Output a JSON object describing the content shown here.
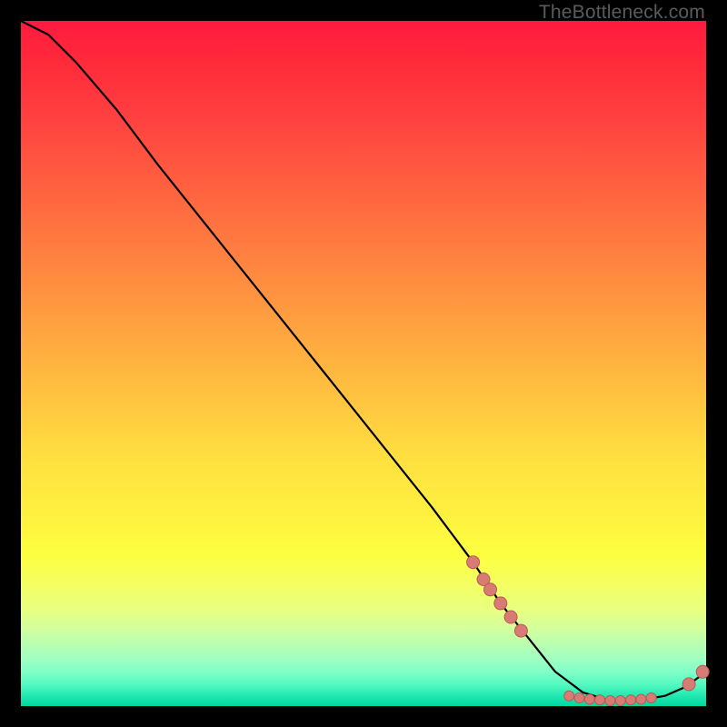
{
  "watermark": "TheBottleneck.com",
  "chart_data": {
    "type": "line",
    "title": "",
    "xlabel": "",
    "ylabel": "",
    "xlim": [
      0,
      100
    ],
    "ylim": [
      0,
      100
    ],
    "curve": {
      "x": [
        0,
        4,
        8,
        14,
        20,
        28,
        36,
        44,
        52,
        60,
        66,
        70,
        74,
        78,
        82,
        86,
        90,
        94,
        97,
        100
      ],
      "y": [
        100,
        98,
        94,
        87,
        79,
        69,
        59,
        49,
        39,
        29,
        21,
        15,
        10,
        5,
        2,
        0.8,
        0.8,
        1.5,
        2.8,
        5
      ]
    },
    "points_left_cluster": {
      "x": [
        66,
        67.5,
        68.5,
        70,
        71.5,
        73
      ],
      "y": [
        21,
        18.5,
        17,
        15,
        13,
        11
      ]
    },
    "points_bottom_cluster": {
      "x": [
        80,
        81.5,
        83,
        84.5,
        86,
        87.5,
        89,
        90.5,
        92
      ],
      "y": [
        1.5,
        1.2,
        1.0,
        0.9,
        0.8,
        0.8,
        0.9,
        1.0,
        1.2
      ]
    },
    "points_right_cluster": {
      "x": [
        97.5,
        99.5
      ],
      "y": [
        3.2,
        5.0
      ]
    },
    "colors": {
      "curve": "#000000",
      "dot_fill": "#d87b74",
      "dot_stroke": "#b85b54"
    }
  }
}
